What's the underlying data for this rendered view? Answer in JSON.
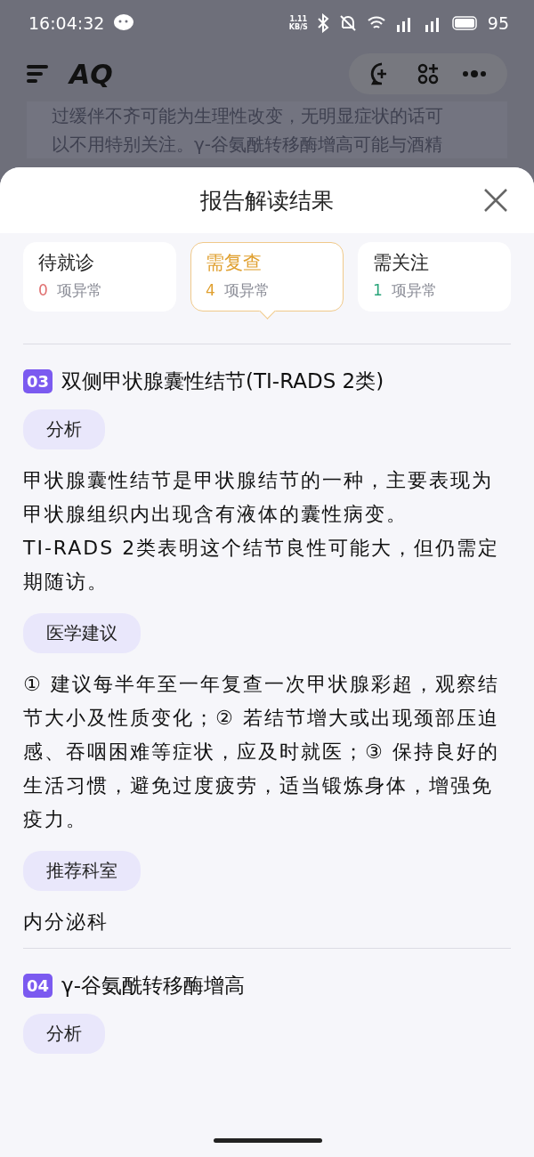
{
  "status_bar": {
    "time": "16:04:32",
    "net_speed": "1.11",
    "net_unit": "KB/S",
    "battery": "95"
  },
  "app_header": {
    "logo": "AQ"
  },
  "background_text": [
    "过缓伴不齐可能为生理性改变，无明显症状的话可",
    "以不用特别关注。γ-谷氨酰转移酶增高可能与酒精"
  ],
  "sheet": {
    "title": "报告解读结果",
    "tabs": [
      {
        "label": "待就诊",
        "count": "0",
        "suffix": "项异常",
        "color": "#e07070",
        "selected": false
      },
      {
        "label": "需复查",
        "count": "4",
        "suffix": "项异常",
        "color": "#e0a030",
        "selected": true
      },
      {
        "label": "需关注",
        "count": "1",
        "suffix": "项异常",
        "color": "#2aa57a",
        "selected": false
      }
    ],
    "sections": [
      {
        "number": "03",
        "title": "双侧甲状腺囊性结节(TI-RADS 2类)",
        "blocks": [
          {
            "label": "分析",
            "text": "甲状腺囊性结节是甲状腺结节的一种，主要表现为甲状腺组织内出现含有液体的囊性病变。\nTI-RADS 2类表明这个结节良性可能大，但仍需定期随访。"
          },
          {
            "label": "医学建议",
            "text": "① 建议每半年至一年复查一次甲状腺彩超，观察结节大小及性质变化；② 若结节增大或出现颈部压迫感、吞咽困难等症状，应及时就医；③ 保持良好的生活习惯，避免过度疲劳，适当锻炼身体，增强免疫力。"
          },
          {
            "label": "推荐科室",
            "text": "内分泌科"
          }
        ]
      },
      {
        "number": "04",
        "title": "γ-谷氨酰转移酶增高",
        "blocks": [
          {
            "label": "分析"
          }
        ]
      }
    ]
  }
}
